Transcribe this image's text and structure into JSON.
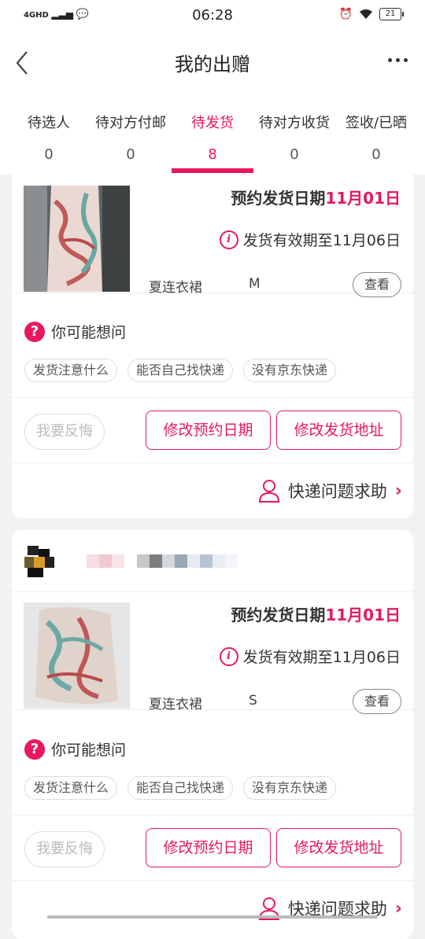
{
  "status_bar": {
    "network": "4GHD",
    "time": "06:28",
    "battery": "21"
  },
  "header": {
    "title": "我的出赠"
  },
  "tabs": [
    {
      "label": "待选人",
      "count": "0"
    },
    {
      "label": "待对方付邮",
      "count": "0"
    },
    {
      "label": "待发货",
      "count": "8"
    },
    {
      "label": "待对方收货",
      "count": "0"
    },
    {
      "label": "签收/已晒",
      "count": "0"
    }
  ],
  "colors": {
    "accent": "#e8185c"
  },
  "orders": [
    {
      "ship_date_label": "预约发货日期",
      "ship_date_value": "11月01日",
      "validity": "发货有效期至11月06日",
      "item_name": "夏连衣裙",
      "item_size": "M",
      "view_label": "查看",
      "faq_title": "你可能想问",
      "chips": [
        "发货注意什么",
        "能否自己找快递",
        "没有京东快递"
      ],
      "regret_label": "我要反悔",
      "modify_date_label": "修改预约日期",
      "modify_address_label": "修改发货地址",
      "help_label": "快递问题求助"
    },
    {
      "ship_date_label": "预约发货日期",
      "ship_date_value": "11月01日",
      "validity": "发货有效期至11月06日",
      "item_name": "夏连衣裙",
      "item_size": "S",
      "view_label": "查看",
      "faq_title": "你可能想问",
      "chips": [
        "发货注意什么",
        "能否自己找快递",
        "没有京东快递"
      ],
      "regret_label": "我要反悔",
      "modify_date_label": "修改预约日期",
      "modify_address_label": "修改发货地址",
      "help_label": "快递问题求助"
    }
  ]
}
